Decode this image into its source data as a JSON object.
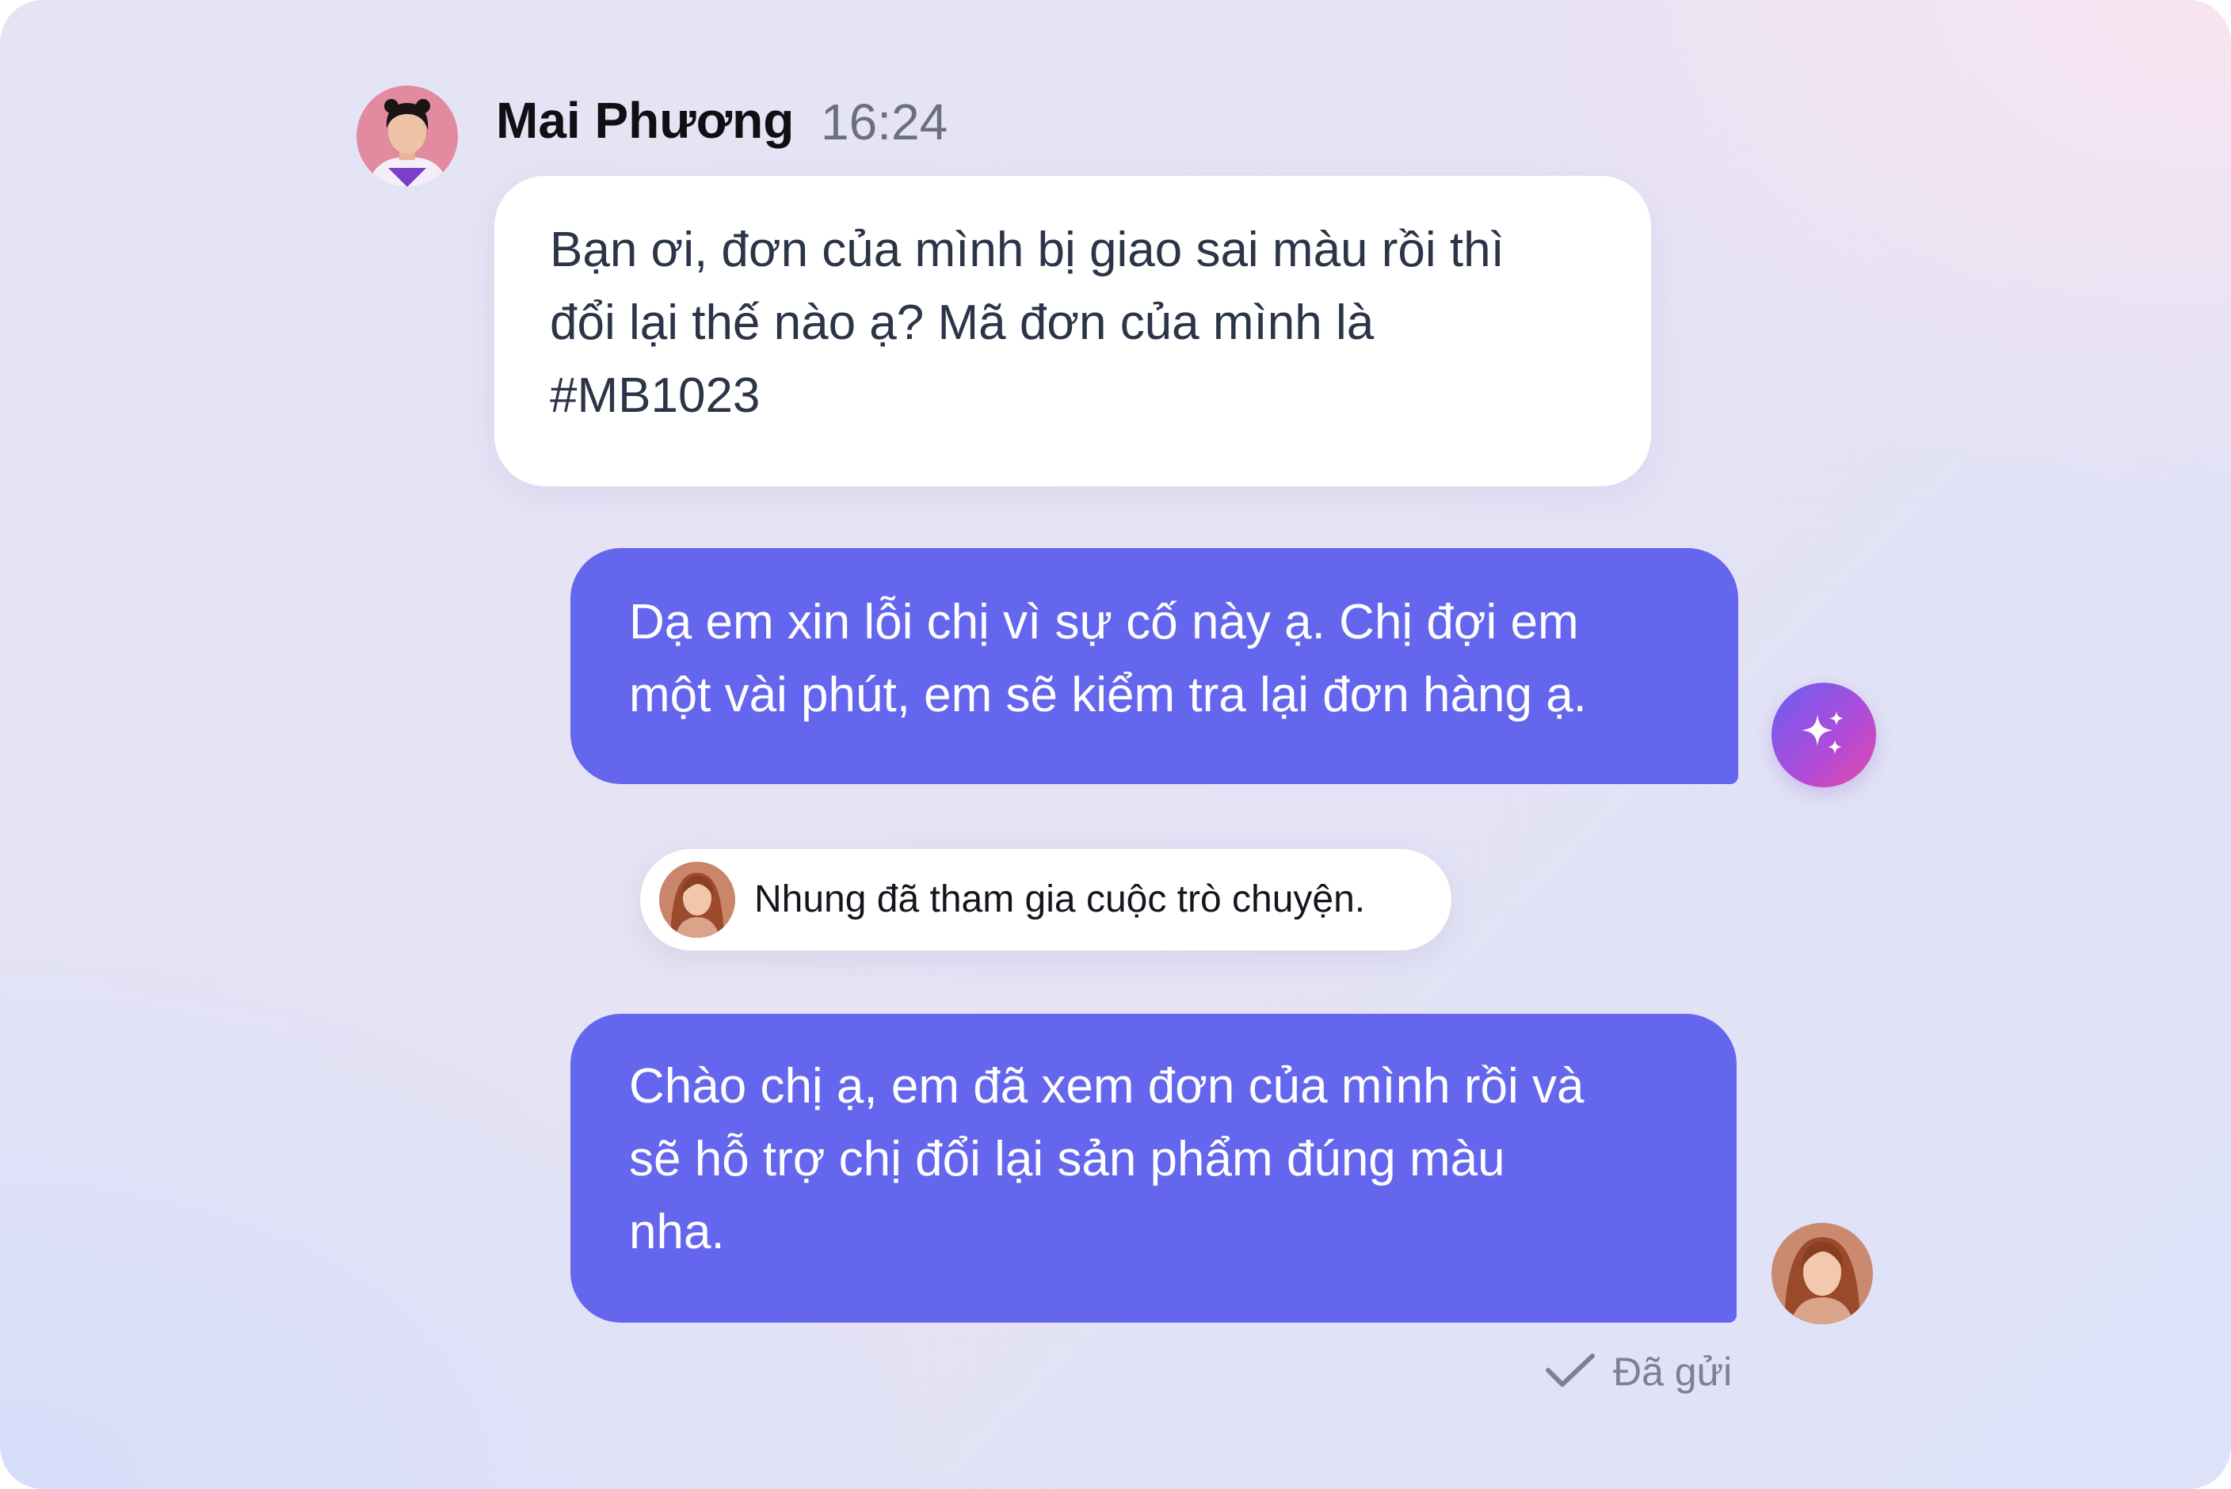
{
  "conversation": {
    "incoming": {
      "sender_name": "Mai Phương",
      "time": "16:24",
      "lines": [
        "Bạn ơi, đơn của mình bị giao sai màu rồi thì",
        "đổi lại thế nào ạ? Mã đơn của mình là",
        "#MB1023"
      ]
    },
    "ai_reply": {
      "lines": [
        "Dạ em xin lỗi chị vì sự cố này ạ. Chị đợi em",
        "một vài phút, em sẽ kiểm tra lại đơn hàng ạ."
      ],
      "badge_icon": "sparkles-icon"
    },
    "system_event": {
      "text": "Nhung đã tham gia cuộc trò chuyện."
    },
    "agent_reply": {
      "lines": [
        "Chào chị ạ, em đã xem đơn của mình rồi và",
        "sẽ hỗ trợ chị đổi lại sản phẩm đúng màu",
        "nha."
      ],
      "status_icon": "checkmark-icon",
      "status": "Đã gửi"
    }
  },
  "colors": {
    "outgoing_bubble": "#6566ee",
    "incoming_bubble": "#ffffff",
    "ai_badge_gradient": [
      "#6a5ef5",
      "#e24ba8"
    ]
  }
}
